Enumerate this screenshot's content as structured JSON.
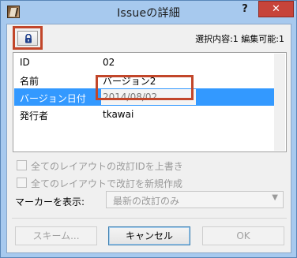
{
  "window": {
    "title": "Issueの詳細",
    "help": "?",
    "close": "✕"
  },
  "header": {
    "selection_info": "選択内容:1 編集可能:1"
  },
  "properties": [
    {
      "key": "ID",
      "value": "02"
    },
    {
      "key": "名前",
      "value": "バージョン2"
    },
    {
      "key": "バージョン日付",
      "value": "2014/08/02"
    },
    {
      "key": "発行者",
      "value": "tkawai"
    }
  ],
  "options": {
    "overwrite_revision_id": "全てのレイアウトの改訂IDを上書き",
    "create_new_revision": "全てのレイアウトで改訂を新規作成",
    "marker_label": "マーカーを表示:",
    "marker_value": "最新の改訂のみ"
  },
  "buttons": {
    "scheme": "スキーム...",
    "cancel": "キャンセル",
    "ok": "OK"
  },
  "colors": {
    "highlight": "#c2462a",
    "selection": "#3399ff",
    "titlebar": "#a7c9ee",
    "close": "#c7443a"
  }
}
